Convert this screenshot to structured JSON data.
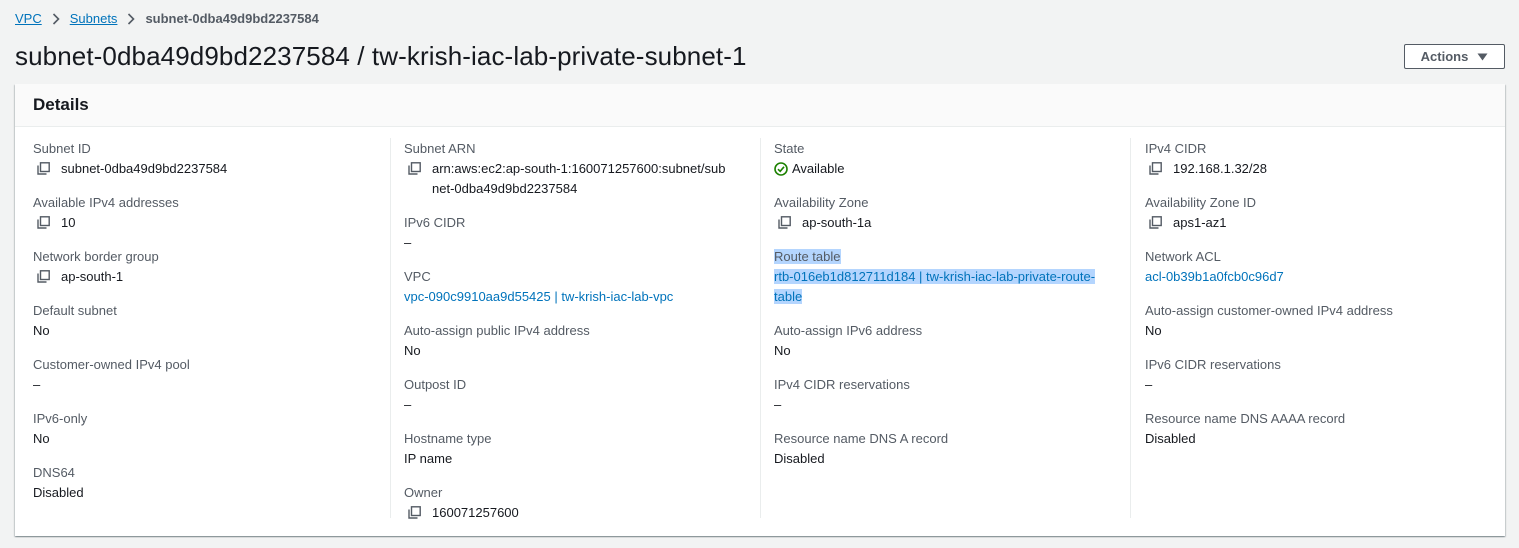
{
  "breadcrumb": {
    "vpc": "VPC",
    "subnets": "Subnets",
    "current": "subnet-0dba49d9bd2237584"
  },
  "page": {
    "title": "subnet-0dba49d9bd2237584 / tw-krish-iac-lab-private-subnet-1",
    "actions_label": "Actions"
  },
  "details": {
    "heading": "Details",
    "col1": {
      "subnet_id": {
        "label": "Subnet ID",
        "value": "subnet-0dba49d9bd2237584"
      },
      "available_ipv4": {
        "label": "Available IPv4 addresses",
        "value": "10"
      },
      "network_border_group": {
        "label": "Network border group",
        "value": "ap-south-1"
      },
      "default_subnet": {
        "label": "Default subnet",
        "value": "No"
      },
      "customer_owned_pool": {
        "label": "Customer-owned IPv4 pool",
        "value": "–"
      },
      "ipv6_only": {
        "label": "IPv6-only",
        "value": "No"
      },
      "dns64": {
        "label": "DNS64",
        "value": "Disabled"
      }
    },
    "col2": {
      "subnet_arn": {
        "label": "Subnet ARN",
        "value": "arn:aws:ec2:ap-south-1:160071257600:subnet/subnet-0dba49d9bd2237584"
      },
      "ipv6_cidr": {
        "label": "IPv6 CIDR",
        "value": "–"
      },
      "vpc": {
        "label": "VPC",
        "value": "vpc-090c9910aa9d55425 | tw-krish-iac-lab-vpc"
      },
      "auto_assign_public_ipv4": {
        "label": "Auto-assign public IPv4 address",
        "value": "No"
      },
      "outpost_id": {
        "label": "Outpost ID",
        "value": "–"
      },
      "hostname_type": {
        "label": "Hostname type",
        "value": "IP name"
      },
      "owner": {
        "label": "Owner",
        "value": "160071257600"
      }
    },
    "col3": {
      "state": {
        "label": "State",
        "value": "Available"
      },
      "availability_zone": {
        "label": "Availability Zone",
        "value": "ap-south-1a"
      },
      "route_table": {
        "label": "Route table",
        "value": "rtb-016eb1d812711d184 | tw-krish-iac-lab-private-route-table"
      },
      "auto_assign_ipv6": {
        "label": "Auto-assign IPv6 address",
        "value": "No"
      },
      "ipv4_cidr_reservations": {
        "label": "IPv4 CIDR reservations",
        "value": "–"
      },
      "dns_a_record": {
        "label": "Resource name DNS A record",
        "value": "Disabled"
      }
    },
    "col4": {
      "ipv4_cidr": {
        "label": "IPv4 CIDR",
        "value": "192.168.1.32/28"
      },
      "availability_zone_id": {
        "label": "Availability Zone ID",
        "value": "aps1-az1"
      },
      "network_acl": {
        "label": "Network ACL",
        "value": "acl-0b39b1a0fcb0c96d7"
      },
      "auto_assign_customer_owned": {
        "label": "Auto-assign customer-owned IPv4 address",
        "value": "No"
      },
      "ipv6_cidr_reservations": {
        "label": "IPv6 CIDR reservations",
        "value": "–"
      },
      "dns_aaaa_record": {
        "label": "Resource name DNS AAAA record",
        "value": "Disabled"
      }
    }
  },
  "colors": {
    "link": "#0073bb",
    "success": "#1d8102",
    "highlight": "#b4d5fe"
  },
  "icons": {
    "copy": "copy-icon",
    "chevron": "chevron-right-icon",
    "caret": "caret-down-icon",
    "status": "check-circle-icon"
  }
}
